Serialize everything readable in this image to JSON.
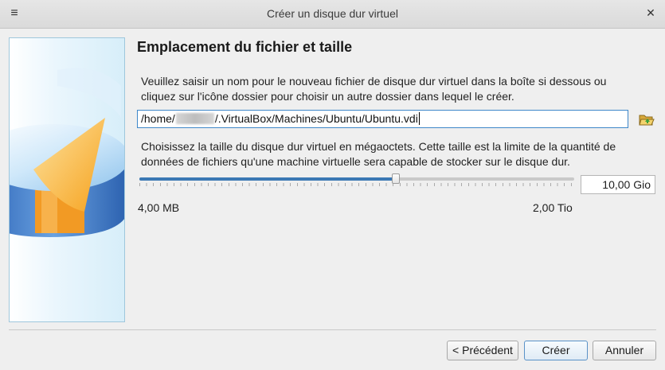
{
  "window": {
    "title": "Créer un disque dur virtuel",
    "menu_icon": "hamburger-icon",
    "close_icon": "close-icon"
  },
  "page": {
    "heading": "Emplacement du fichier et taille",
    "location_description_line1": "Veuillez saisir un nom pour le nouveau fichier de disque dur virtuel dans la boîte si dessous ou",
    "location_description_line2": "cliquez sur l'icône dossier pour choisir un autre dossier dans lequel le créer.",
    "path_prefix": "/home/",
    "path_suffix": "/.VirtualBox/Machines/Ubuntu/Ubuntu.vdi",
    "folder_icon": "folder-open-icon",
    "size_description_line1": "Choisissez la taille du disque dur virtuel en mégaoctets. Cette taille est la limite de la quantité de",
    "size_description_line2": "données de fichiers qu'une machine virtuelle sera capable de stocker sur le disque dur.",
    "size_value": "10,00 Gio",
    "slider_fraction": 0.59,
    "range_min": "4,00 MB",
    "range_max": "2,00 Tio"
  },
  "buttons": {
    "back": "< Précédent",
    "create": "Créer",
    "cancel": "Annuler"
  },
  "colors": {
    "accent": "#3b78b4",
    "banner_border": "#9fc7dc"
  }
}
